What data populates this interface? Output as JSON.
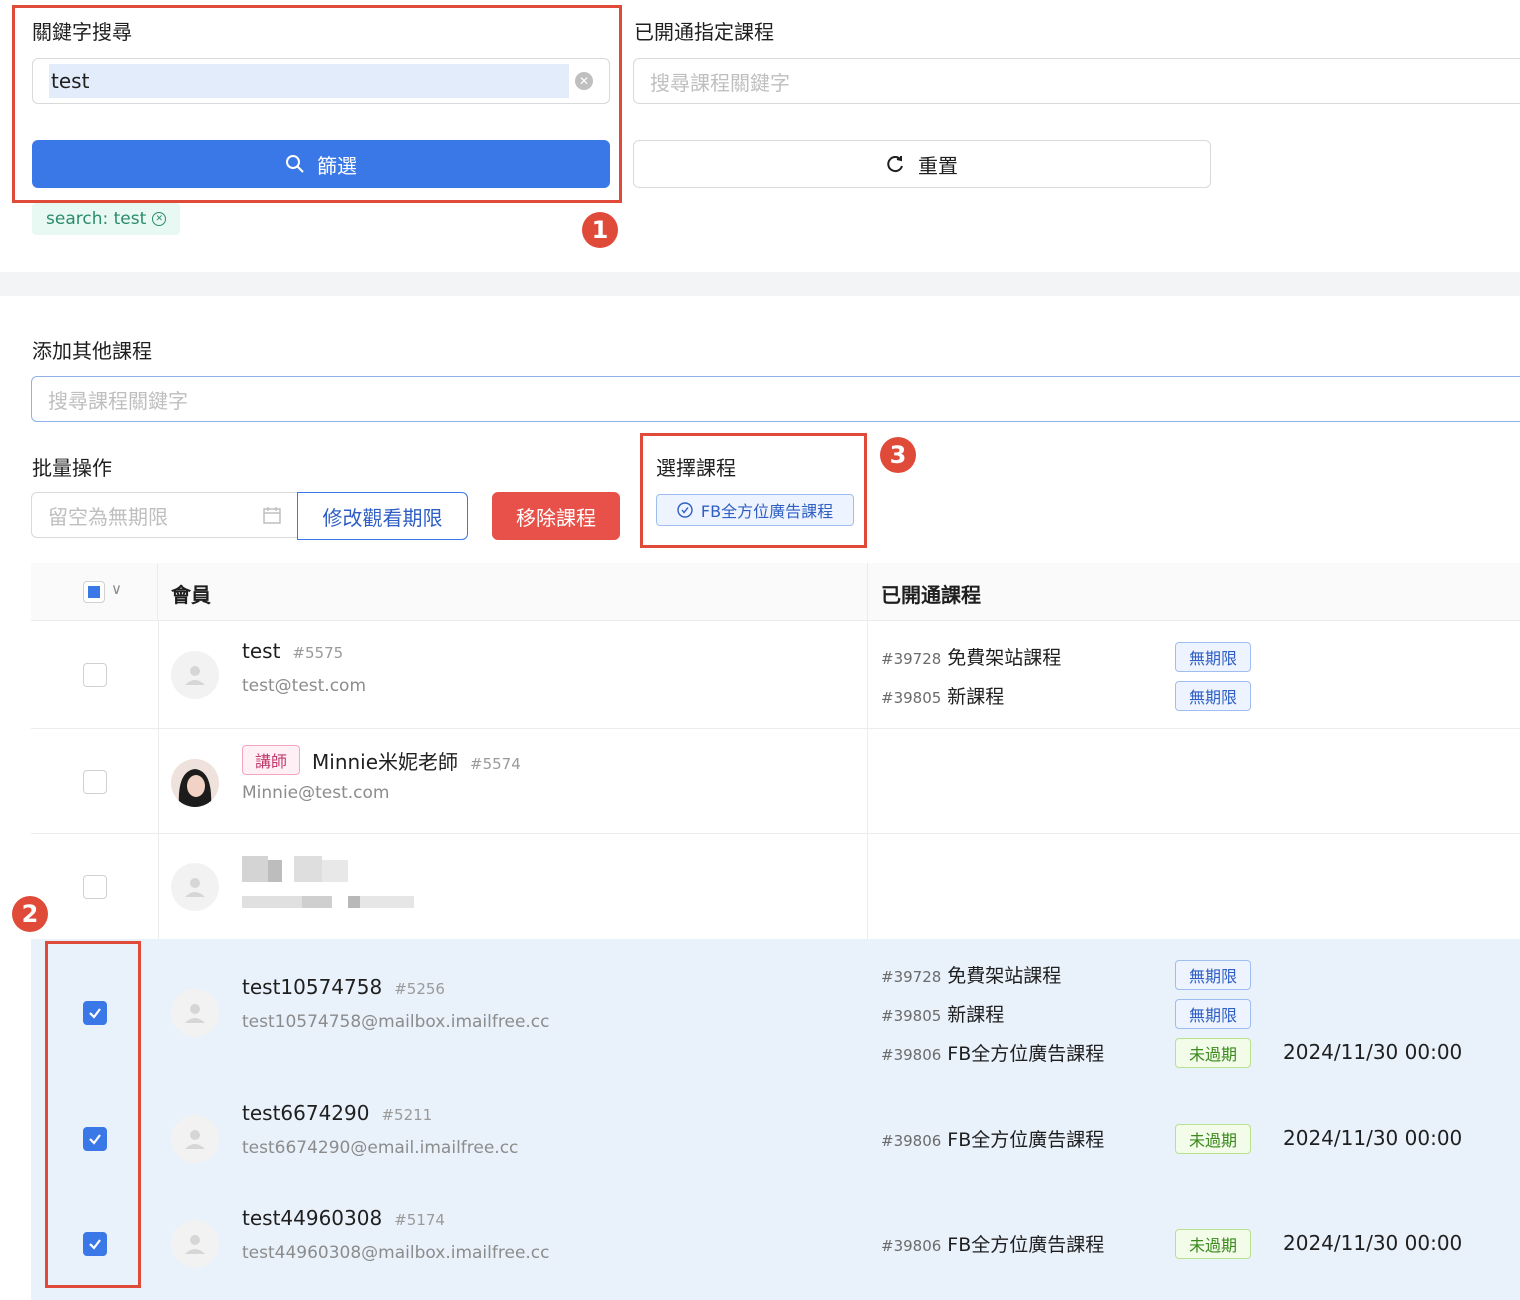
{
  "filter": {
    "keyword_label": "關鍵字搜尋",
    "keyword_value": "test",
    "filter_button": "篩選",
    "active_tag": "search: test",
    "course_label": "已開通指定課程",
    "course_placeholder": "搜尋課程關鍵字",
    "reset_button": "重置"
  },
  "add_course": {
    "label": "添加其他課程",
    "placeholder": "搜尋課程關鍵字"
  },
  "batch": {
    "label": "批量操作",
    "date_placeholder": "留空為無期限",
    "modify_button": "修改觀看期限",
    "remove_button": "移除課程"
  },
  "select_course": {
    "label": "選擇課程",
    "chip": "FB全方位廣告課程"
  },
  "markers": [
    "1",
    "2",
    "3"
  ],
  "table": {
    "col_member": "會員",
    "col_courses": "已開通課程",
    "rows": [
      {
        "name": "test",
        "id": "#5575",
        "email": "test@test.com",
        "role": "",
        "checked": false,
        "courses": [
          {
            "id": "#39728",
            "name": "免費架站課程",
            "status": "無期限",
            "date": ""
          },
          {
            "id": "#39805",
            "name": "新課程",
            "status": "無期限",
            "date": ""
          }
        ]
      },
      {
        "name": "Minnie米妮老師",
        "id": "#5574",
        "email": "Minnie@test.com",
        "role": "講師",
        "checked": false,
        "courses": []
      },
      {
        "name": "",
        "id": "",
        "email": "",
        "role": "",
        "checked": false,
        "courses": []
      },
      {
        "name": "test10574758",
        "id": "#5256",
        "email": "test10574758@mailbox.imailfree.cc",
        "role": "",
        "checked": true,
        "courses": [
          {
            "id": "#39728",
            "name": "免費架站課程",
            "status": "無期限",
            "date": ""
          },
          {
            "id": "#39805",
            "name": "新課程",
            "status": "無期限",
            "date": ""
          },
          {
            "id": "#39806",
            "name": "FB全方位廣告課程",
            "status": "未過期",
            "date": "2024/11/30 00:00"
          }
        ]
      },
      {
        "name": "test6674290",
        "id": "#5211",
        "email": "test6674290@email.imailfree.cc",
        "role": "",
        "checked": true,
        "courses": [
          {
            "id": "#39806",
            "name": "FB全方位廣告課程",
            "status": "未過期",
            "date": "2024/11/30 00:00"
          }
        ]
      },
      {
        "name": "test44960308",
        "id": "#5174",
        "email": "test44960308@mailbox.imailfree.cc",
        "role": "",
        "checked": true,
        "courses": [
          {
            "id": "#39806",
            "name": "FB全方位廣告課程",
            "status": "未過期",
            "date": "2024/11/30 00:00"
          }
        ]
      }
    ]
  },
  "colors": {
    "primary": "#3b78e7",
    "danger": "#e8514a",
    "annotation": "#e04a39",
    "selected_row": "#e9f1fb"
  }
}
